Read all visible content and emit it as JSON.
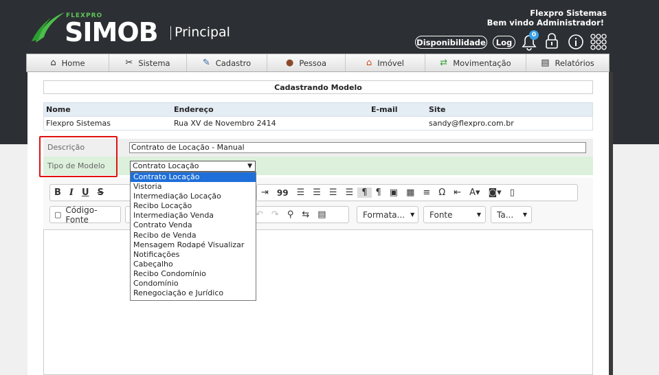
{
  "header": {
    "brand_small": "FLEXPRO",
    "brand_main": "SIMOB",
    "brand_sub": "Principal",
    "company": "Flexpro Sistemas",
    "welcome": "Bem vindo Administrador!",
    "availability_label": "Disponibilidade",
    "log_label": "Log",
    "notification_count": "0",
    "icons": [
      "bell-icon",
      "lock-icon",
      "info-icon",
      "apps-grid-icon"
    ]
  },
  "nav": {
    "items": [
      {
        "label": "Home",
        "icon": "home-icon"
      },
      {
        "label": "Sistema",
        "icon": "tools-icon"
      },
      {
        "label": "Cadastro",
        "icon": "pen-icon"
      },
      {
        "label": "Pessoa",
        "icon": "person-icon"
      },
      {
        "label": "Imóvel",
        "icon": "house-icon"
      },
      {
        "label": "Movimentação",
        "icon": "transfer-icon"
      },
      {
        "label": "Relatórios",
        "icon": "clipboard-icon"
      }
    ]
  },
  "form": {
    "title": "Cadastrando Modelo",
    "info_headers": [
      "Nome",
      "Endereço",
      "E-mail",
      "Site"
    ],
    "info_values": [
      "Flexpro Sistemas",
      "Rua XV de Novembro 2414",
      "",
      "sandy@flexpro.com.br"
    ],
    "description_label": "Descrição",
    "description_value": "Contrato de Locação - Manual",
    "type_label": "Tipo de Modelo",
    "type_selected": "Contrato Locação",
    "type_options": [
      "Contrato Locação",
      "Vistoria",
      "Intermediação Locação",
      "Recibo Locação",
      "Intermediação Venda",
      "Contrato Venda",
      "Recibo de Venda",
      "Mensagem Rodapé Visualizar",
      "Notificações",
      "Cabeçalho",
      "Recibo Condomínio",
      "Condomínio",
      "Renegociação e Jurídico"
    ]
  },
  "editor": {
    "source_label": "Código-Fonte",
    "format_label": "Formata...",
    "font_label": "Fonte",
    "size_label": "Ta...",
    "bold": "B",
    "italic": "I",
    "underline": "U",
    "strike": "S",
    "quote": "99",
    "omega": "Ω"
  }
}
